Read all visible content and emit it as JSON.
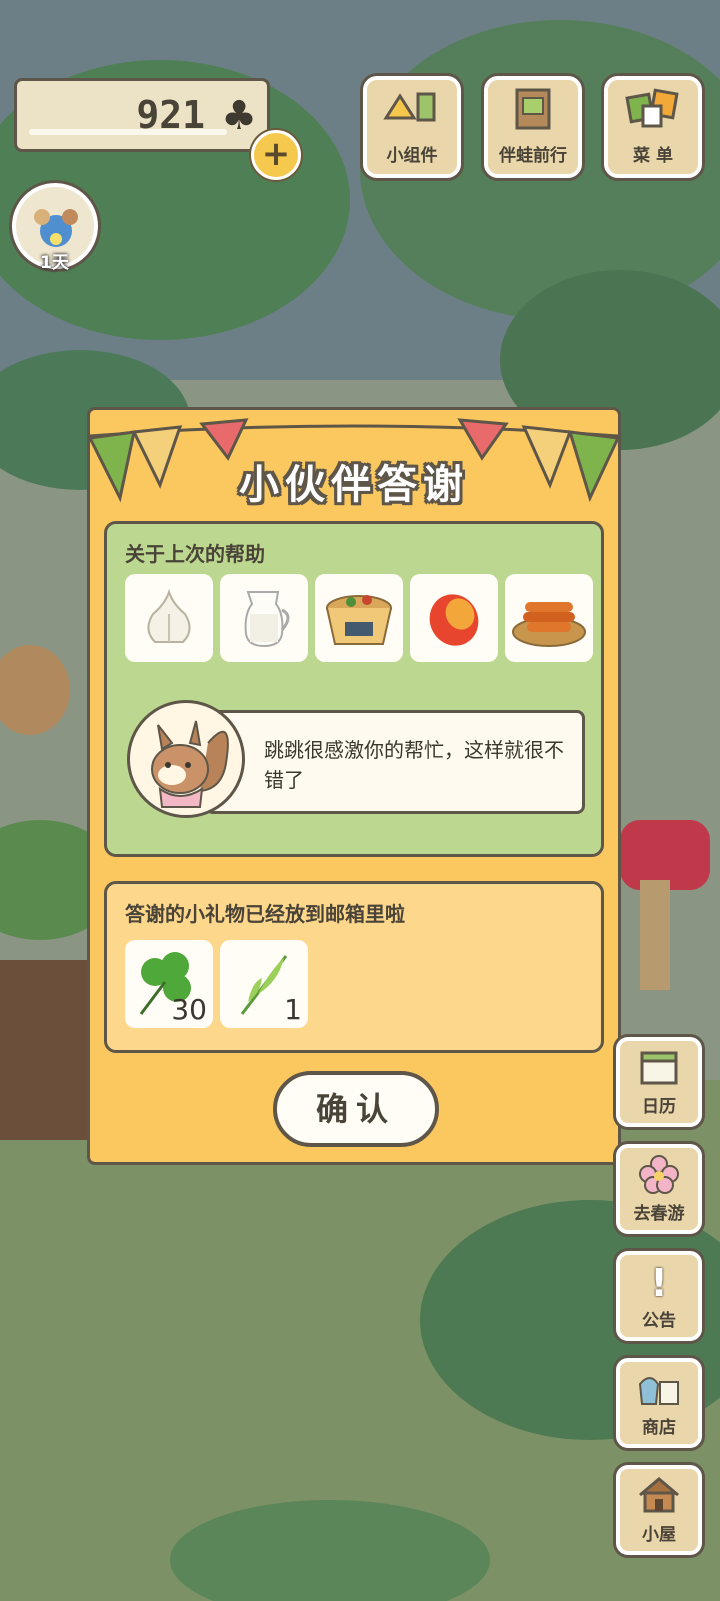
{
  "hud": {
    "clover_count": "921",
    "clover_icon": "clover-icon",
    "add_button": "+",
    "top_buttons": [
      {
        "label": "小组件",
        "icon": "widget-icon"
      },
      {
        "label": "伴蛙前行",
        "icon": "journal-icon"
      },
      {
        "label": "菜 单",
        "icon": "menu-cards-icon"
      }
    ],
    "travel_days": "1天"
  },
  "dialog": {
    "title": "小伙伴答谢",
    "help_section": {
      "heading": "关于上次的帮助",
      "items": [
        {
          "icon": "garlic-icon"
        },
        {
          "icon": "milk-pitcher-icon"
        },
        {
          "icon": "noodle-cup-icon"
        },
        {
          "icon": "mango-icon"
        },
        {
          "icon": "glazed-snack-icon"
        }
      ],
      "message": "跳跳很感激你的帮忙，这样就很不错了"
    },
    "gift_section": {
      "heading": "答谢的小礼物已经放到邮箱里啦",
      "rewards": [
        {
          "icon": "clover-icon",
          "count": "30"
        },
        {
          "icon": "grass-sprig-icon",
          "count": "1"
        }
      ]
    },
    "confirm_label": "确认"
  },
  "side_buttons": [
    {
      "label": "日历",
      "icon": "calendar-icon"
    },
    {
      "label": "去春游",
      "icon": "flower-icon"
    },
    {
      "label": "公告",
      "icon": "exclamation-icon"
    },
    {
      "label": "商店",
      "icon": "shop-bags-icon"
    },
    {
      "label": "小屋",
      "icon": "house-icon"
    }
  ],
  "colors": {
    "dialog_bg": "#fbc85f",
    "panel_green": "#bcd890",
    "panel_yellow": "#fdd88c",
    "outline": "#5e5648"
  }
}
